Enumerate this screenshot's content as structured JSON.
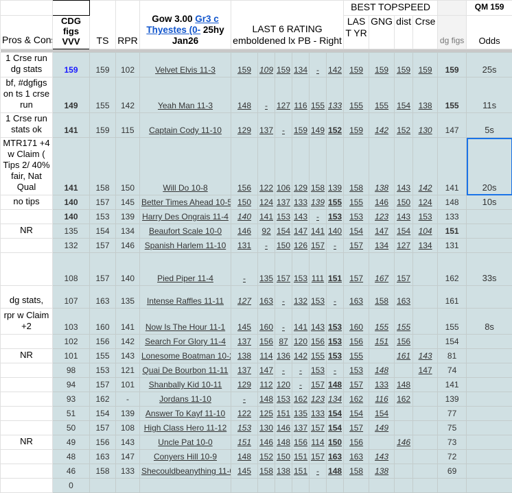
{
  "header": {
    "pros_cons": "Pros & Cons",
    "cdg_figs": "CDG figs VVV",
    "ts": "TS",
    "rpr": "RPR",
    "race_prefix": "Gow 3.00 ",
    "race_link": "Gr3 c Thyestes (0-",
    "race_suffix": " 25hy Jan26",
    "last6_line1": "LAST 6 RATING",
    "last6_line2": "emboldened lx PB - Right",
    "best_topspeed": "BEST TOPSPEED",
    "last_yr": "LAS T YR",
    "gng": "GNG",
    "dist": "dist",
    "crse": "Crse",
    "dg_figs": "dg figs",
    "qm": "QM 159",
    "odds": "Odds"
  },
  "colors": {
    "data_bg": "#d0e0e3",
    "link": "#1155cc",
    "highlight": "#1a1aff",
    "selection": "#1a73e8"
  },
  "rows": [
    {
      "pros": "1 Crse run dg stats",
      "cdg": [
        "159",
        "b blue"
      ],
      "ts": "159",
      "rpr": "102",
      "name": "Velvet Elvis  11-3",
      "last6": [
        [
          "159",
          ""
        ],
        [
          "109",
          "i"
        ],
        [
          "159",
          ""
        ],
        [
          "134",
          ""
        ],
        [
          "-",
          ""
        ],
        [
          "142",
          ""
        ]
      ],
      "best": [
        [
          "159",
          ""
        ],
        [
          "159",
          ""
        ],
        [
          "159",
          ""
        ],
        [
          "159",
          ""
        ]
      ],
      "dg": [
        "159",
        "b"
      ],
      "odds": "25s"
    },
    {
      "pros": "bf, #dgfigs on ts 1 crse run",
      "cdg": [
        "149",
        "b"
      ],
      "ts": "155",
      "rpr": "142",
      "name": "Yeah Man  11-3",
      "last6": [
        [
          "148",
          ""
        ],
        [
          "-",
          ""
        ],
        [
          "127",
          ""
        ],
        [
          "116",
          ""
        ],
        [
          "155",
          ""
        ],
        [
          "133",
          "i"
        ]
      ],
      "best": [
        [
          "155",
          ""
        ],
        [
          "155",
          ""
        ],
        [
          "154",
          ""
        ],
        [
          "138",
          ""
        ]
      ],
      "dg": [
        "155",
        "b"
      ],
      "odds": "11s"
    },
    {
      "pros": "1 Crse run stats ok",
      "cdg": [
        "141",
        "b"
      ],
      "ts": "159",
      "rpr": "115",
      "name": "Captain Cody  11-10",
      "last6": [
        [
          "129",
          ""
        ],
        [
          "137",
          ""
        ],
        [
          "-",
          ""
        ],
        [
          "159",
          ""
        ],
        [
          "149",
          ""
        ],
        [
          "152",
          "b"
        ]
      ],
      "best": [
        [
          "159",
          ""
        ],
        [
          "142",
          "i"
        ],
        [
          "152",
          ""
        ],
        [
          "130",
          "i"
        ]
      ],
      "dg": [
        "147",
        ""
      ],
      "odds": "5s"
    },
    {
      "pros": "MTR171 +4 w Claim ( Tips 2/ 40% fair, Nat Qual",
      "cdg": [
        "141",
        "b"
      ],
      "ts": "158",
      "rpr": "150",
      "name": "Will Do  10-8",
      "last6": [
        [
          "156",
          ""
        ],
        [
          "122",
          ""
        ],
        [
          "106",
          ""
        ],
        [
          "129",
          ""
        ],
        [
          "158",
          ""
        ],
        [
          "139",
          ""
        ]
      ],
      "best": [
        [
          "158",
          ""
        ],
        [
          "138",
          "i"
        ],
        [
          "143",
          ""
        ],
        [
          "142",
          "i"
        ]
      ],
      "dg": [
        "141",
        ""
      ],
      "odds": "20s",
      "selected": true
    },
    {
      "pros": "no tips",
      "cdg": [
        "140",
        "b"
      ],
      "ts": "157",
      "rpr": "145",
      "name": "Better Times Ahead  10-5",
      "last6": [
        [
          "150",
          ""
        ],
        [
          "124",
          ""
        ],
        [
          "137",
          ""
        ],
        [
          "133",
          ""
        ],
        [
          "139",
          "i"
        ],
        [
          "155",
          "b"
        ]
      ],
      "best": [
        [
          "155",
          ""
        ],
        [
          "146",
          ""
        ],
        [
          "150",
          ""
        ],
        [
          "124",
          ""
        ]
      ],
      "dg": [
        "148",
        ""
      ],
      "odds": "10s"
    },
    {
      "pros": "",
      "cdg": [
        "140",
        "b"
      ],
      "ts": "153",
      "rpr": "139",
      "name": "Harry Des Ongrais  11-4",
      "last6": [
        [
          "140",
          "i"
        ],
        [
          "141",
          ""
        ],
        [
          "153",
          ""
        ],
        [
          "143",
          ""
        ],
        [
          "-",
          ""
        ],
        [
          "153",
          "b"
        ]
      ],
      "best": [
        [
          "153",
          ""
        ],
        [
          "123",
          "i"
        ],
        [
          "143",
          ""
        ],
        [
          "153",
          ""
        ]
      ],
      "dg": [
        "133",
        ""
      ],
      "odds": ""
    },
    {
      "pros": "NR",
      "cdg": [
        "135",
        ""
      ],
      "ts": "154",
      "rpr": "134",
      "name": "Beaufort Scale  10-0",
      "last6": [
        [
          "146",
          ""
        ],
        [
          "92",
          ""
        ],
        [
          "154",
          ""
        ],
        [
          "147",
          ""
        ],
        [
          "141",
          ""
        ],
        [
          "140",
          ""
        ]
      ],
      "best": [
        [
          "154",
          ""
        ],
        [
          "147",
          ""
        ],
        [
          "154",
          ""
        ],
        [
          "104",
          "i"
        ]
      ],
      "dg": [
        "151",
        "b"
      ],
      "odds": ""
    },
    {
      "pros": "",
      "cdg": [
        "132",
        ""
      ],
      "ts": "157",
      "rpr": "146",
      "name": "Spanish Harlem  11-10",
      "last6": [
        [
          "131",
          ""
        ],
        [
          "-",
          ""
        ],
        [
          "150",
          ""
        ],
        [
          "126",
          ""
        ],
        [
          "157",
          ""
        ],
        [
          "-",
          ""
        ]
      ],
      "best": [
        [
          "157",
          ""
        ],
        [
          "134",
          ""
        ],
        [
          "127",
          ""
        ],
        [
          "134",
          ""
        ]
      ],
      "dg": [
        "131",
        ""
      ],
      "odds": ""
    },
    {
      "pros": "",
      "cdg": [
        "108",
        ""
      ],
      "ts": "157",
      "rpr": "140",
      "name": "Pied Piper  11-4",
      "last6": [
        [
          "-",
          ""
        ],
        [
          "135",
          ""
        ],
        [
          "157",
          ""
        ],
        [
          "153",
          ""
        ],
        [
          "111",
          ""
        ],
        [
          "151",
          "b"
        ]
      ],
      "best": [
        [
          "157",
          ""
        ],
        [
          "167",
          "i"
        ],
        [
          "157",
          ""
        ],
        [
          "",
          ""
        ]
      ],
      "dg": [
        "162",
        ""
      ],
      "odds": "33s"
    },
    {
      "pros": "dg stats,",
      "cdg": [
        "107",
        ""
      ],
      "ts": "163",
      "rpr": "135",
      "name": "Intense Raffles  11-11",
      "last6": [
        [
          "127",
          "i"
        ],
        [
          "163",
          ""
        ],
        [
          "-",
          ""
        ],
        [
          "132",
          ""
        ],
        [
          "153",
          ""
        ],
        [
          "-",
          ""
        ]
      ],
      "best": [
        [
          "163",
          ""
        ],
        [
          "158",
          ""
        ],
        [
          "163",
          ""
        ],
        [
          "",
          ""
        ]
      ],
      "dg": [
        "161",
        ""
      ],
      "odds": ""
    },
    {
      "pros": "rpr w Claim +2",
      "cdg": [
        "103",
        ""
      ],
      "ts": "160",
      "rpr": "141",
      "name": "Now Is The Hour  11-1",
      "last6": [
        [
          "145",
          ""
        ],
        [
          "160",
          ""
        ],
        [
          "-",
          ""
        ],
        [
          "141",
          ""
        ],
        [
          "143",
          ""
        ],
        [
          "153",
          "b"
        ]
      ],
      "best": [
        [
          "160",
          ""
        ],
        [
          "155",
          "i"
        ],
        [
          "155",
          "i"
        ],
        [
          "",
          ""
        ]
      ],
      "dg": [
        "155",
        ""
      ],
      "odds": "8s"
    },
    {
      "pros": "",
      "cdg": [
        "102",
        ""
      ],
      "ts": "156",
      "rpr": "142",
      "name": "Search For Glory  11-4",
      "last6": [
        [
          "137",
          ""
        ],
        [
          "156",
          ""
        ],
        [
          "87",
          ""
        ],
        [
          "120",
          ""
        ],
        [
          "156",
          ""
        ],
        [
          "153",
          "b"
        ]
      ],
      "best": [
        [
          "156",
          ""
        ],
        [
          "151",
          "i"
        ],
        [
          "156",
          ""
        ],
        [
          "",
          ""
        ]
      ],
      "dg": [
        "154",
        ""
      ],
      "odds": ""
    },
    {
      "pros": "NR",
      "cdg": [
        "101",
        ""
      ],
      "ts": "155",
      "rpr": "143",
      "name": "Lonesome Boatman  10-2",
      "last6": [
        [
          "138",
          ""
        ],
        [
          "114",
          ""
        ],
        [
          "136",
          ""
        ],
        [
          "142",
          ""
        ],
        [
          "155",
          ""
        ],
        [
          "153",
          "b"
        ]
      ],
      "best": [
        [
          "155",
          ""
        ],
        [
          "",
          ""
        ],
        [
          "161",
          "i"
        ],
        [
          "143",
          "i"
        ]
      ],
      "dg": [
        "81",
        ""
      ],
      "odds": ""
    },
    {
      "pros": "",
      "cdg": [
        "98",
        ""
      ],
      "ts": "153",
      "rpr": "121",
      "name": "Quai De Bourbon  11-11",
      "last6": [
        [
          "137",
          ""
        ],
        [
          "147",
          ""
        ],
        [
          "-",
          ""
        ],
        [
          "-",
          ""
        ],
        [
          "153",
          ""
        ],
        [
          "-",
          ""
        ]
      ],
      "best": [
        [
          "153",
          ""
        ],
        [
          "148",
          "i"
        ],
        [
          "",
          ""
        ],
        [
          "147",
          ""
        ]
      ],
      "dg": [
        "74",
        ""
      ],
      "odds": ""
    },
    {
      "pros": "",
      "cdg": [
        "94",
        ""
      ],
      "ts": "157",
      "rpr": "101",
      "name": "Shanbally Kid  10-11",
      "last6": [
        [
          "129",
          ""
        ],
        [
          "112",
          ""
        ],
        [
          "120",
          ""
        ],
        [
          "-",
          ""
        ],
        [
          "157",
          ""
        ],
        [
          "148",
          "b"
        ]
      ],
      "best": [
        [
          "157",
          ""
        ],
        [
          "133",
          ""
        ],
        [
          "148",
          ""
        ],
        [
          "",
          ""
        ]
      ],
      "dg": [
        "141",
        ""
      ],
      "odds": ""
    },
    {
      "pros": "",
      "cdg": [
        "93",
        ""
      ],
      "ts": "162",
      "rpr": "-",
      "name": "Jordans  11-10",
      "last6": [
        [
          "-",
          ""
        ],
        [
          "148",
          ""
        ],
        [
          "153",
          ""
        ],
        [
          "162",
          ""
        ],
        [
          "123",
          "i"
        ],
        [
          "134",
          "i"
        ]
      ],
      "best": [
        [
          "162",
          ""
        ],
        [
          "116",
          "i"
        ],
        [
          "162",
          ""
        ],
        [
          "",
          ""
        ]
      ],
      "dg": [
        "139",
        ""
      ],
      "odds": ""
    },
    {
      "pros": "",
      "cdg": [
        "51",
        ""
      ],
      "ts": "154",
      "rpr": "139",
      "name": "Answer To Kayf  11-10",
      "last6": [
        [
          "122",
          ""
        ],
        [
          "125",
          ""
        ],
        [
          "151",
          ""
        ],
        [
          "135",
          ""
        ],
        [
          "133",
          ""
        ],
        [
          "154",
          "b"
        ]
      ],
      "best": [
        [
          "154",
          ""
        ],
        [
          "154",
          ""
        ],
        [
          "",
          ""
        ],
        [
          "",
          ""
        ]
      ],
      "dg": [
        "77",
        ""
      ],
      "odds": ""
    },
    {
      "pros": "",
      "cdg": [
        "50",
        ""
      ],
      "ts": "157",
      "rpr": "108",
      "name": "High Class Hero  11-12",
      "last6": [
        [
          "153",
          "i"
        ],
        [
          "130",
          ""
        ],
        [
          "146",
          ""
        ],
        [
          "137",
          ""
        ],
        [
          "157",
          ""
        ],
        [
          "154",
          "b"
        ]
      ],
      "best": [
        [
          "157",
          ""
        ],
        [
          "149",
          "i"
        ],
        [
          "",
          ""
        ],
        [
          "",
          ""
        ]
      ],
      "dg": [
        "75",
        ""
      ],
      "odds": ""
    },
    {
      "pros": "NR",
      "cdg": [
        "49",
        ""
      ],
      "ts": "156",
      "rpr": "143",
      "name": "Uncle Pat  10-0",
      "last6": [
        [
          "151",
          "i"
        ],
        [
          "146",
          ""
        ],
        [
          "148",
          ""
        ],
        [
          "156",
          ""
        ],
        [
          "114",
          ""
        ],
        [
          "150",
          "b"
        ]
      ],
      "best": [
        [
          "156",
          ""
        ],
        [
          "",
          ""
        ],
        [
          "146",
          "i"
        ],
        [
          "",
          ""
        ]
      ],
      "dg": [
        "73",
        ""
      ],
      "odds": ""
    },
    {
      "pros": "",
      "cdg": [
        "48",
        ""
      ],
      "ts": "163",
      "rpr": "147",
      "name": "Conyers Hill  10-9",
      "last6": [
        [
          "148",
          ""
        ],
        [
          "152",
          ""
        ],
        [
          "150",
          ""
        ],
        [
          "151",
          ""
        ],
        [
          "157",
          ""
        ],
        [
          "163",
          "b"
        ]
      ],
      "best": [
        [
          "163",
          ""
        ],
        [
          "143",
          "i"
        ],
        [
          "",
          ""
        ],
        [
          "",
          ""
        ]
      ],
      "dg": [
        "72",
        ""
      ],
      "odds": ""
    },
    {
      "pros": "",
      "cdg": [
        "46",
        ""
      ],
      "ts": "158",
      "rpr": "133",
      "name": "Shecouldbeanything  11-0",
      "last6": [
        [
          "145",
          ""
        ],
        [
          "158",
          ""
        ],
        [
          "138",
          ""
        ],
        [
          "151",
          ""
        ],
        [
          "-",
          ""
        ],
        [
          "148",
          "b"
        ]
      ],
      "best": [
        [
          "158",
          ""
        ],
        [
          "138",
          "i"
        ],
        [
          "",
          ""
        ],
        [
          "",
          ""
        ]
      ],
      "dg": [
        "69",
        ""
      ],
      "odds": ""
    },
    {
      "pros": "",
      "cdg": [
        "0",
        ""
      ],
      "ts": "",
      "rpr": "",
      "name": "",
      "last6": [
        [
          "",
          ""
        ],
        [
          "",
          ""
        ],
        [
          "",
          ""
        ],
        [
          "",
          ""
        ],
        [
          "",
          ""
        ],
        [
          "",
          ""
        ]
      ],
      "best": [
        [
          "",
          ""
        ],
        [
          "",
          ""
        ],
        [
          "",
          ""
        ],
        [
          "",
          ""
        ]
      ],
      "dg": [
        "",
        ""
      ],
      "odds": ""
    }
  ]
}
